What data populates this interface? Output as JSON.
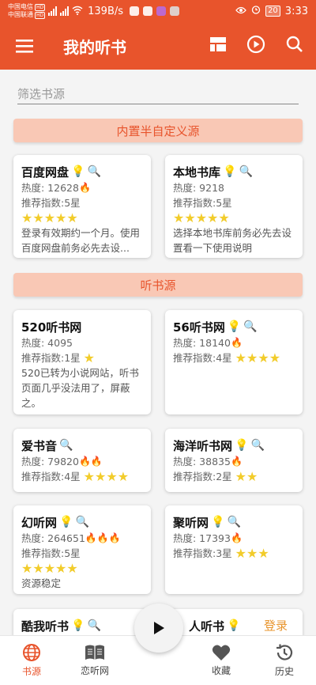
{
  "status_bar": {
    "carrier1": "中国电信",
    "carrier2": "中国联通",
    "hd": "HD",
    "network": "4G",
    "speed": "139B/s",
    "battery": "20",
    "time": "3:33"
  },
  "app_bar": {
    "title": "我的听书",
    "icons": [
      "menu-icon",
      "dashboard-icon",
      "play-circle-icon",
      "search-icon"
    ]
  },
  "filter": {
    "placeholder": "筛选书源"
  },
  "sections": {
    "custom": "内置半自定义源",
    "listen": "听书源"
  },
  "cards": {
    "baidu": {
      "name": "百度网盘",
      "heat": "热度: 12628",
      "rating": "推荐指数:5星",
      "stars": "★★★★★",
      "desc": "登录有效期约一个月。使用百度网盘前务必先去设..."
    },
    "local": {
      "name": "本地书库",
      "heat": "热度: 9218",
      "rating": "推荐指数:5星",
      "stars": "★★★★★",
      "desc": "选择本地书库前务必先去设置看一下使用说明"
    },
    "s520": {
      "name": "520听书网",
      "heat": "热度: 4095",
      "rating": "推荐指数:1星",
      "stars": "★",
      "desc": "520已转为小说网站，听书页面几乎没法用了，屏蔽之。"
    },
    "s56": {
      "name": "56听书网",
      "heat": "热度: 18140",
      "rating": "推荐指数:4星",
      "stars": "★★★★"
    },
    "aishuyin": {
      "name": "爱书音",
      "heat": "热度: 79820",
      "rating": "推荐指数:4星",
      "stars": "★★★★"
    },
    "haiyang": {
      "name": "海洋听书网",
      "heat": "热度: 38835",
      "rating": "推荐指数:2星",
      "stars": "★★"
    },
    "huanting": {
      "name": "幻听网",
      "heat": "热度: 264651",
      "rating": "推荐指数:5星",
      "stars": "★★★★★",
      "desc": "资源稳定"
    },
    "juting": {
      "name": "聚听网",
      "heat": "热度: 17393",
      "rating": "推荐指数:3星",
      "stars": "★★★"
    },
    "kuwo": {
      "name": "酷我听书"
    },
    "partial": {
      "name": "人听书"
    }
  },
  "login_link": "登录",
  "bottom_nav": [
    {
      "label": "书源",
      "icon": "globe-icon"
    },
    {
      "label": "恋听网",
      "icon": "book-icon"
    },
    {
      "label": "收藏",
      "icon": "heart-icon"
    },
    {
      "label": "历史",
      "icon": "history-icon"
    }
  ],
  "colors": {
    "primary": "#e8542c",
    "section_bg": "#f9c8b5",
    "star": "#f2cc2b",
    "login": "#e8942c"
  }
}
